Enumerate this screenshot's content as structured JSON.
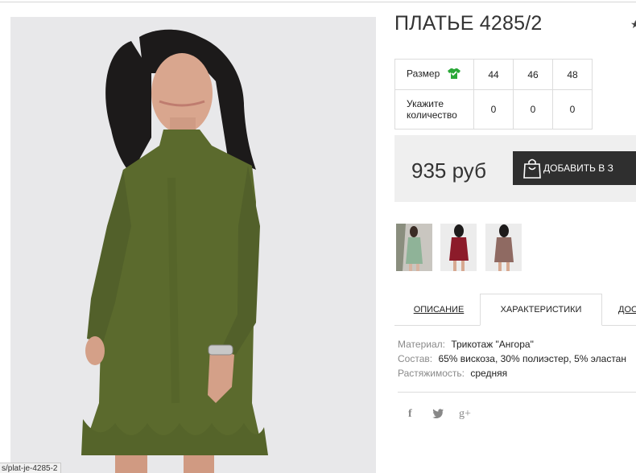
{
  "product": {
    "title": "ПЛАТЬЕ 4285/2",
    "price": "935 руб",
    "add_to_cart": "ДОБАВИТЬ В З"
  },
  "size_table": {
    "size_label": "Размер",
    "qty_label": "Укажите количество",
    "sizes": [
      "44",
      "46",
      "48"
    ],
    "quantities": [
      "0",
      "0",
      "0"
    ]
  },
  "tabs": {
    "description": "ОПИСАНИЕ",
    "characteristics": "ХАРАКТЕРИСТИКИ",
    "delivery": "ДОС"
  },
  "specs": [
    {
      "key": "Материал:",
      "value": "Трикотаж \"Ангора\""
    },
    {
      "key": "Состав:",
      "value": "65% вискоза, 30% полиэстер, 5% эластан"
    },
    {
      "key": "Растяжимость:",
      "value": "средняя"
    }
  ],
  "social": {
    "facebook": "f",
    "twitter": "🐦",
    "google_plus": "g+"
  },
  "status_url": "s/plat-je-4285-2",
  "colors": {
    "dress_green": "#5b6a2d",
    "dress_burgundy": "#8c1b2a",
    "dress_mauve": "#8f6a62",
    "button_dark": "#2f2f2f",
    "price_bg": "#efefef"
  }
}
